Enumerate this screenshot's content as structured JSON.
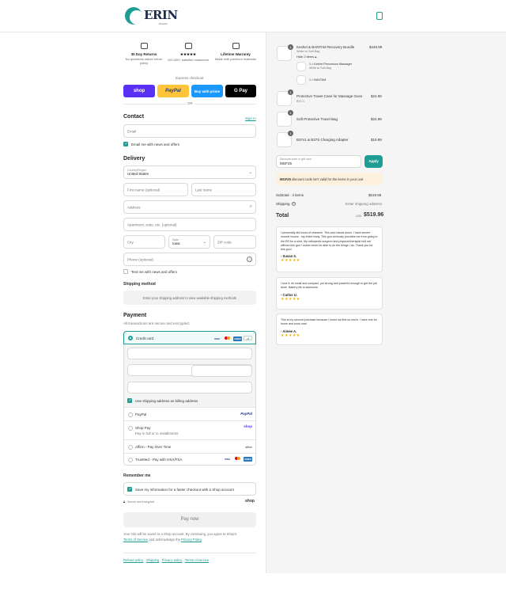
{
  "header": {
    "logo_text": "ERIN",
    "logo_tagline": "Kinetic"
  },
  "trust": [
    {
      "title": "30 Day Returns",
      "sub": "No questions asked return policy",
      "icon": "truck-icon"
    },
    {
      "title": "★★★★★",
      "sub": "100,000+ satisfied customers",
      "icon": "crown-icon"
    },
    {
      "title": "Lifetime Warranty",
      "sub": "Made with premium materials",
      "icon": "certificate-icon"
    }
  ],
  "express": {
    "label": "Express checkout",
    "shop": "shop",
    "paypal": "PayPal",
    "amazon": "Buy with prime",
    "gpay": "G Pay",
    "or": "OR"
  },
  "contact": {
    "title": "Contact",
    "signin": "Sign in",
    "email_placeholder": "Email",
    "news_label": "Email me with news and offers"
  },
  "delivery": {
    "title": "Delivery",
    "country_label": "Country/Region",
    "country_value": "United States",
    "first_name": "First name (optional)",
    "last_name": "Last name",
    "address": "Address",
    "apartment": "Apartment, suite, etc. (optional)",
    "city": "City",
    "state_label": "State",
    "state_value": "Iowa",
    "zip": "ZIP code",
    "phone": "Phone (optional)",
    "text_label": "Text me with news and offers"
  },
  "shipping": {
    "title": "Shipping method",
    "note": "Enter your shipping address to view available shipping methods"
  },
  "payment": {
    "title": "Payment",
    "sub": "All transactions are secure and encrypted.",
    "credit_card": "Credit card",
    "more_cards": "+5",
    "billing_same": "Use shipping address as billing address",
    "paypal": "PayPal",
    "paypal_logo": "PayPal",
    "shop_pay": "Shop Pay",
    "shop_pay_sub": "Pay in full or in installments",
    "shop_pay_logo": "shop",
    "affirm": "Affirm - Pay Over Time",
    "affirm_logo": "affirm",
    "trumed": "TrueMed - Pay with HSA/FSA",
    "visa": "VISA",
    "amex": "AMEX"
  },
  "remember": {
    "title": "Remember me",
    "label": "Save my information for a faster checkout with a Shop account",
    "secure": "Secure and encrypted",
    "shop_logo": "shop"
  },
  "pay_now": "Pay now",
  "legal": {
    "line1": "Your info will be saved to a Shop account. By continuing, you agree to Shop's",
    "terms": "Terms of Service",
    "and": "and acknowledge the",
    "privacy": "Privacy Policy",
    "end": "."
  },
  "footer_links": [
    "Refund policy",
    "Shipping",
    "Privacy policy",
    "Terms of service"
  ],
  "cart": {
    "items": [
      {
        "qty": "1",
        "name": "Keshel & BANTAM Recovery Bundle",
        "variant": "White w/ Soft Bag",
        "extra": "Hide 2 items ▴",
        "price": "$449.99"
      },
      {
        "qty": "1",
        "name": "Protective Travel Case for Massage Guns",
        "variant": "B37-C",
        "price": "$24.99"
      },
      {
        "qty": "1",
        "name": "Soft Protective Travel Bag",
        "variant": "",
        "price": "$24.99"
      },
      {
        "qty": "1",
        "name": "B37v1 & B37S Charging Adapter",
        "variant": "",
        "price": "$19.99"
      }
    ],
    "sub_items": [
      {
        "name": "1 × Keshel Percussion Massager",
        "variant": "White w/ Soft Bag"
      },
      {
        "name": "1 × BANTAM",
        "variant": ""
      }
    ],
    "discount_label": "Discount code or gift card",
    "discount_value": "MGF25",
    "apply": "Apply",
    "error_code": "MGF25",
    "error_text": "discount code isn't valid for the items in your cart",
    "subtotal_label": "Subtotal · 4 items",
    "subtotal": "$519.96",
    "shipping_label": "Shipping",
    "shipping_value": "Enter shipping address",
    "total_label": "Total",
    "currency": "USD",
    "total": "$519.96"
  },
  "reviews": [
    {
      "quote": "I personally did hours of research. This won hands down. I have severe muscle issues - my entire body. This gun seriously provides me from going to the ER for a shot. My orthopedic surgeon and physical therapist told me without this gun I would never be able to do the things I do. Thank you for this gun!",
      "author": "- Susan S.",
      "stars": "★★★★★"
    },
    {
      "quote": "I love it, its small and compact, yet strong and powerful enough to get the job done. Battery life is awesome.",
      "author": "- Carlos U.",
      "stars": "★★★★★"
    },
    {
      "quote": "This is my second purchase because I loved my first so much. I have one for home and work now!",
      "author": "- Aimee A.",
      "stars": "★★★★★"
    }
  ]
}
